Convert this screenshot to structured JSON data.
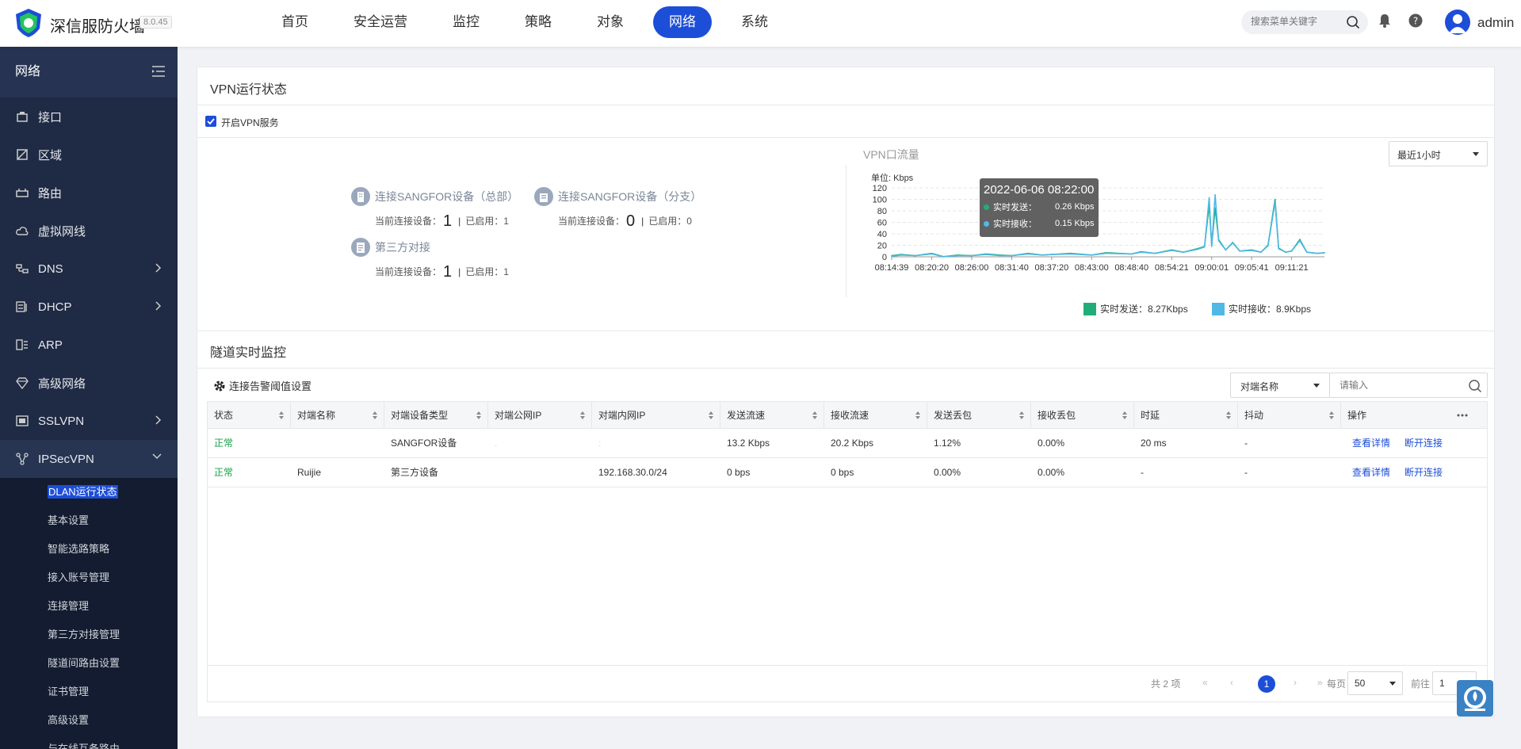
{
  "header": {
    "brand": "深信服防火墙",
    "version": "8.0.45",
    "nav": [
      "首页",
      "安全运营",
      "监控",
      "策略",
      "对象",
      "网络",
      "系统"
    ],
    "active_nav": "网络",
    "search_placeholder": "搜索菜单关键字",
    "username": "admin"
  },
  "sidebar": {
    "title": "网络",
    "items": [
      {
        "label": "接口",
        "icon": "interface-icon"
      },
      {
        "label": "区域",
        "icon": "zone-icon"
      },
      {
        "label": "路由",
        "icon": "route-icon"
      },
      {
        "label": "虚拟网线",
        "icon": "cloud-icon"
      },
      {
        "label": "DNS",
        "icon": "dns-icon"
      },
      {
        "label": "DHCP",
        "icon": "dhcp-icon"
      },
      {
        "label": "ARP",
        "icon": "arp-icon"
      },
      {
        "label": "高级网络",
        "icon": "diamond-icon"
      },
      {
        "label": "SSLVPN",
        "icon": "sslvpn-icon"
      },
      {
        "label": "IPSecVPN",
        "icon": "ipsecvpn-icon"
      }
    ],
    "sub_items": [
      "DLAN运行状态",
      "基本设置",
      "智能选路策略",
      "接入账号管理",
      "连接管理",
      "第三方对接管理",
      "隧道间路由设置",
      "证书管理",
      "高级设置",
      "与在线互备路由"
    ]
  },
  "vpn_status": {
    "title": "VPN运行状态",
    "enable_label": "开启VPN服务",
    "hq": {
      "title": "连接SANGFOR设备（总部）",
      "current_label": "当前连接设备：",
      "current": "1",
      "enabled_label": "已启用：",
      "enabled": "1"
    },
    "branch": {
      "title": "连接SANGFOR设备（分支）",
      "current_label": "当前连接设备：",
      "current": "0",
      "enabled_label": "已启用：",
      "enabled": "0"
    },
    "third": {
      "title": "第三方对接",
      "current_label": "当前连接设备：",
      "current": "1",
      "enabled_label": "已启用：",
      "enabled": "1"
    }
  },
  "traffic": {
    "title": "VPN口流量",
    "range": "最近1小时",
    "tooltip": {
      "time": "2022-06-06 08:22:00",
      "send_label": "实时发送：",
      "send": "0.26 Kbps",
      "recv_label": "实时接收：",
      "recv": "0.15 Kbps"
    },
    "legend_send": "实时发送：8.27Kbps",
    "legend_recv": "实时接收：8.9Kbps"
  },
  "chart_data": {
    "type": "line",
    "ylabel": "单位: Kbps",
    "ylim": [
      0,
      120
    ],
    "yticks": [
      "0",
      "20",
      "40",
      "60",
      "80",
      "100",
      "120"
    ],
    "xticks": [
      "08:14:39",
      "08:20:20",
      "08:26:00",
      "08:31:40",
      "08:37:20",
      "08:43:00",
      "08:48:40",
      "08:54:21",
      "09:00:01",
      "09:05:41",
      "09:11:21"
    ],
    "x_start": "08:14:39",
    "x_end": "09:16:00",
    "colors": {
      "send": "#1fae7a",
      "recv": "#4fb8e6"
    },
    "series": [
      {
        "name": "实时发送",
        "points": [
          [
            "08:14:39",
            2
          ],
          [
            "08:16:00",
            4
          ],
          [
            "08:18:00",
            2
          ],
          [
            "08:20:20",
            6
          ],
          [
            "08:22:00",
            0.26
          ],
          [
            "08:24:00",
            3
          ],
          [
            "08:26:00",
            2
          ],
          [
            "08:28:00",
            5
          ],
          [
            "08:30:00",
            3
          ],
          [
            "08:31:40",
            2
          ],
          [
            "08:34:00",
            6
          ],
          [
            "08:36:00",
            3
          ],
          [
            "08:37:20",
            4
          ],
          [
            "08:40:00",
            6
          ],
          [
            "08:43:00",
            3
          ],
          [
            "08:45:00",
            7
          ],
          [
            "08:48:40",
            5
          ],
          [
            "08:50:00",
            9
          ],
          [
            "08:52:00",
            6
          ],
          [
            "08:54:21",
            12
          ],
          [
            "08:56:00",
            8
          ],
          [
            "08:58:00",
            14
          ],
          [
            "08:59:00",
            18
          ],
          [
            "08:59:40",
            90
          ],
          [
            "09:00:01",
            20
          ],
          [
            "09:00:30",
            85
          ],
          [
            "09:01:00",
            30
          ],
          [
            "09:02:00",
            12
          ],
          [
            "09:03:00",
            25
          ],
          [
            "09:04:00",
            10
          ],
          [
            "09:05:41",
            12
          ],
          [
            "09:07:00",
            8
          ],
          [
            "09:08:00",
            20
          ],
          [
            "09:09:00",
            100
          ],
          [
            "09:09:30",
            15
          ],
          [
            "09:10:30",
            8
          ],
          [
            "09:11:21",
            10
          ],
          [
            "09:12:30",
            30
          ],
          [
            "09:13:30",
            8
          ],
          [
            "09:15:00",
            6
          ],
          [
            "09:16:00",
            7
          ]
        ]
      },
      {
        "name": "实时接收",
        "points": [
          [
            "08:14:39",
            1
          ],
          [
            "08:16:00",
            3
          ],
          [
            "08:18:00",
            2
          ],
          [
            "08:20:20",
            5
          ],
          [
            "08:22:00",
            0.15
          ],
          [
            "08:24:00",
            2
          ],
          [
            "08:26:00",
            2
          ],
          [
            "08:28:00",
            4
          ],
          [
            "08:30:00",
            2
          ],
          [
            "08:31:40",
            2
          ],
          [
            "08:34:00",
            5
          ],
          [
            "08:36:00",
            3
          ],
          [
            "08:37:20",
            4
          ],
          [
            "08:40:00",
            5
          ],
          [
            "08:43:00",
            3
          ],
          [
            "08:45:00",
            6
          ],
          [
            "08:48:40",
            5
          ],
          [
            "08:50:00",
            8
          ],
          [
            "08:52:00",
            6
          ],
          [
            "08:54:21",
            11
          ],
          [
            "08:56:00",
            8
          ],
          [
            "08:58:00",
            13
          ],
          [
            "08:59:00",
            17
          ],
          [
            "08:59:40",
            103
          ],
          [
            "09:00:01",
            18
          ],
          [
            "09:00:30",
            108
          ],
          [
            "09:01:00",
            28
          ],
          [
            "09:02:00",
            12
          ],
          [
            "09:03:00",
            24
          ],
          [
            "09:04:00",
            10
          ],
          [
            "09:05:41",
            11
          ],
          [
            "09:07:00",
            8
          ],
          [
            "09:08:00",
            19
          ],
          [
            "09:09:00",
            95
          ],
          [
            "09:09:30",
            14
          ],
          [
            "09:10:30",
            8
          ],
          [
            "09:11:21",
            10
          ],
          [
            "09:12:30",
            28
          ],
          [
            "09:13:30",
            8
          ],
          [
            "09:15:00",
            6
          ],
          [
            "09:16:00",
            7
          ]
        ]
      }
    ]
  },
  "tunnel": {
    "title": "隧道实时监控",
    "settings_label": "连接告警阈值设置",
    "filter_select": "对端名称",
    "filter_placeholder": "请输入",
    "columns": [
      "状态",
      "对端名称",
      "对端设备类型",
      "对端公网IP",
      "对端内网IP",
      "发送流速",
      "接收流速",
      "发送丢包",
      "接收丢包",
      "时延",
      "抖动",
      "操作"
    ],
    "rows": [
      {
        "status": "正常",
        "name": "",
        "type": "SANGFOR设备",
        "public_ip": ".",
        "private_ip": ":",
        "send": "13.2 Kbps",
        "recv": "20.2 Kbps",
        "send_loss": "1.12%",
        "recv_loss": "0.00%",
        "latency": "20 ms",
        "jitter": "-",
        "detail": "查看详情",
        "disconnect": "断开连接"
      },
      {
        "status": "正常",
        "name": "Ruijie",
        "type": "第三方设备",
        "public_ip": "",
        "private_ip": "192.168.30.0/24",
        "send": "0 bps",
        "recv": "0 bps",
        "send_loss": "0.00%",
        "recv_loss": "0.00%",
        "latency": "-",
        "jitter": "-",
        "detail": "查看详情",
        "disconnect": "断开连接"
      }
    ],
    "pager": {
      "total": "共 2 项",
      "first": "«",
      "prev": "‹",
      "current": "1",
      "next": "›",
      "last": "»",
      "per_page_label": "每页",
      "per_page": "50",
      "goto_label": "前往",
      "goto": "1"
    }
  }
}
